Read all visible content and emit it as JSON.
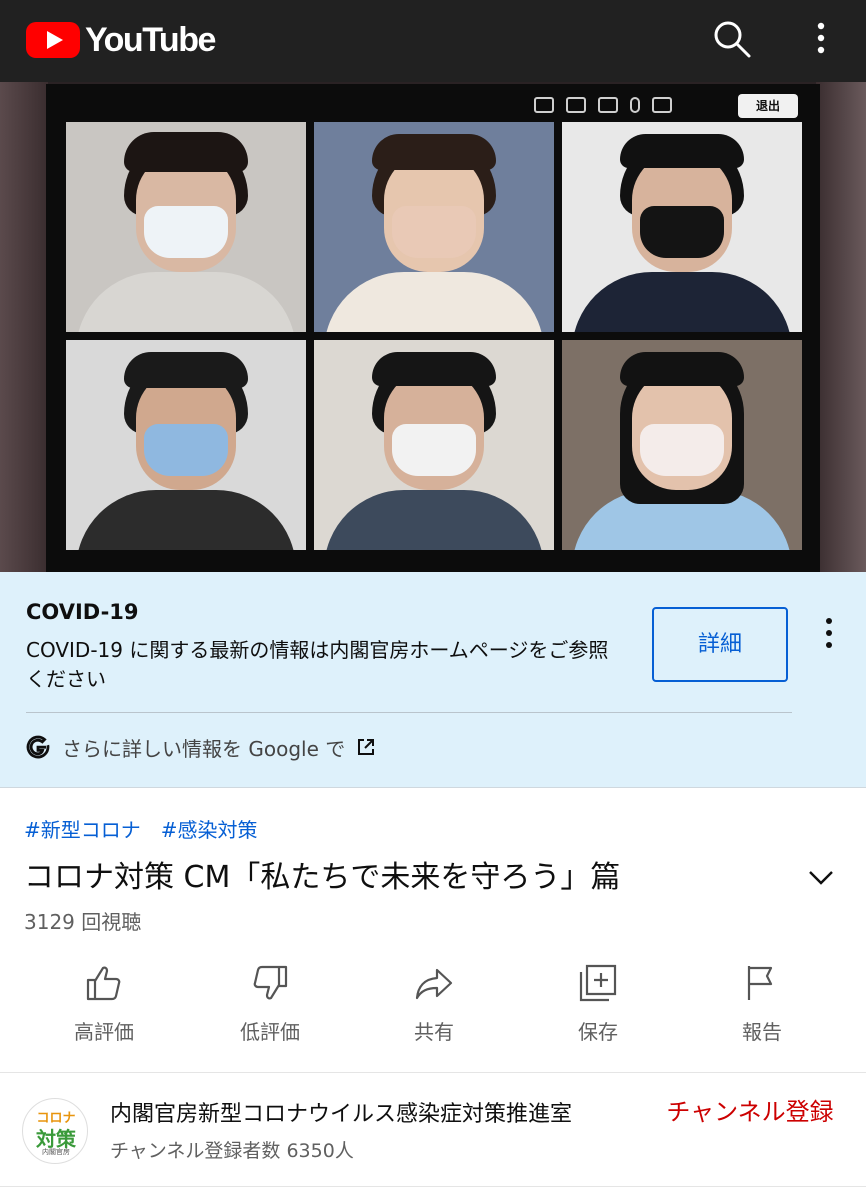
{
  "header": {
    "logo_text": "YouTube",
    "icons": [
      "search-icon",
      "more-vert-icon"
    ]
  },
  "video": {
    "meeting_leave_label": "退出"
  },
  "info_panel": {
    "title": "COVID-19",
    "body": "COVID-19 に関する最新の情報は内閣官房ホームページをご参照ください",
    "button_label": "詳細",
    "google_text": "さらに詳しい情報を Google で",
    "colors": {
      "background": "#def1fb",
      "link": "#065fd4"
    }
  },
  "meta": {
    "hashtags": [
      "#新型コロナ",
      "#感染対策"
    ],
    "title": "コロナ対策 CM「私たちで未来を守ろう」篇",
    "views": "3129 回視聴"
  },
  "actions": [
    {
      "label": "高評価",
      "icon": "thumbs-up-icon"
    },
    {
      "label": "低評価",
      "icon": "thumbs-down-icon"
    },
    {
      "label": "共有",
      "icon": "share-icon"
    },
    {
      "label": "保存",
      "icon": "save-playlist-icon"
    },
    {
      "label": "報告",
      "icon": "flag-icon"
    }
  ],
  "channel": {
    "name": "内閣官房新型コロナウイルス感染症対策推進室",
    "subscribers": "チャンネル登録者数 6350人",
    "subscribe_label": "チャンネル登録",
    "avatar_line1": "コロナ",
    "avatar_line2": "対策",
    "avatar_line3": "内閣官房",
    "subscribe_color": "#cc0000"
  }
}
